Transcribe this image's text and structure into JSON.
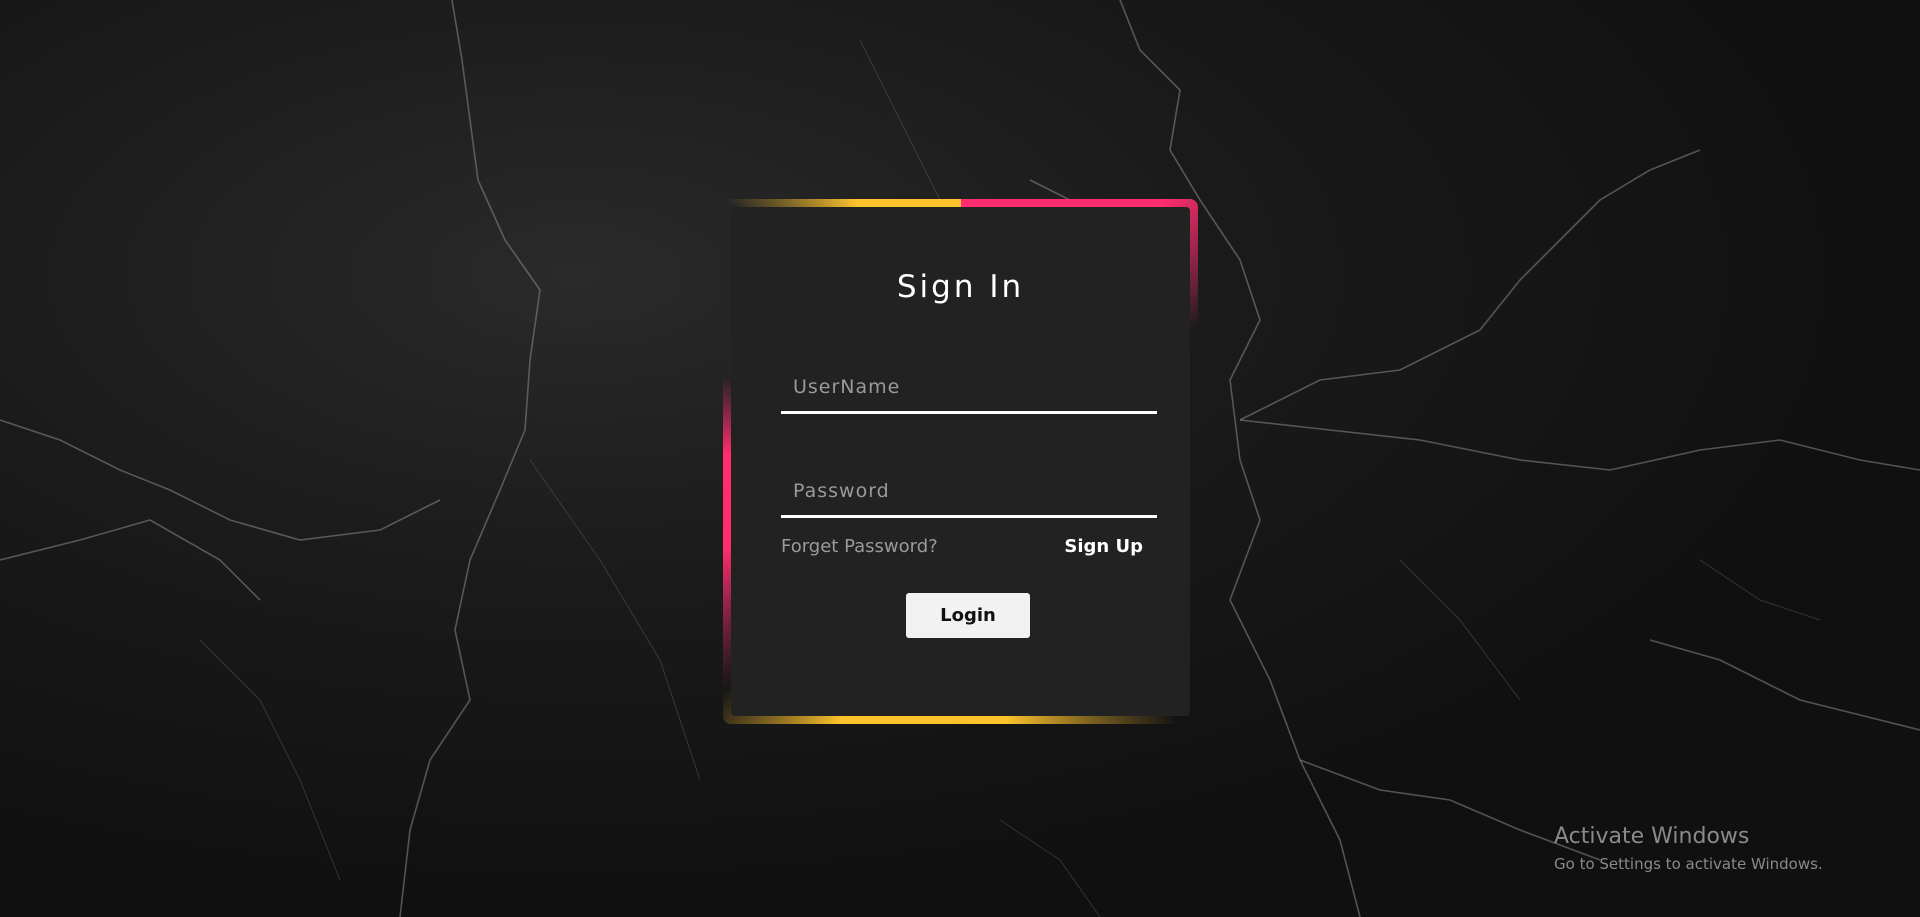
{
  "login": {
    "title": "Sign In",
    "username_placeholder": "UserName",
    "password_placeholder": "Password",
    "forgot_label": "Forget Password?",
    "signup_label": "Sign Up",
    "login_label": "Login"
  },
  "watermark": {
    "title": "Activate Windows",
    "subtitle": "Go to Settings to activate Windows."
  },
  "colors": {
    "accent_pink": "#ff2d6f",
    "accent_yellow": "#fdc32d",
    "card_bg": "#222222",
    "page_bg": "#141414"
  }
}
